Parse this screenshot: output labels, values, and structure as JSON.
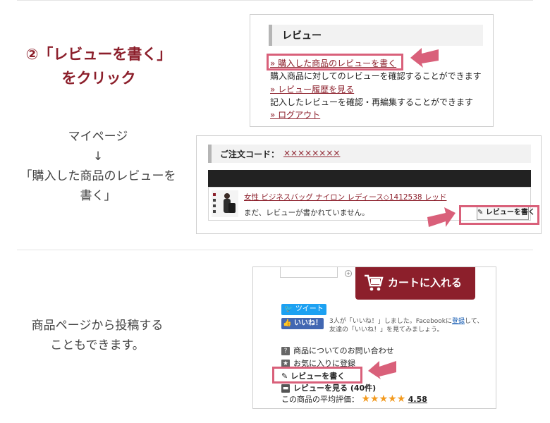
{
  "step": {
    "title_line1": "②「レビューを書く」",
    "title_line2": "をクリック"
  },
  "caption_mypage": {
    "line1": "マイページ",
    "line2": "↓",
    "line3": "「購入した商品のレビューを",
    "line4": "書く」"
  },
  "caption_product": {
    "line1": "商品ページから投稿する",
    "line2": "こともできます。"
  },
  "review_box": {
    "heading": "レビュー",
    "link_write": "» 購入した商品のレビューを書く",
    "desc_write": "購入商品に対してのレビューを確認することができます",
    "link_history": "» レビュー履歴を見る",
    "desc_history": "記入したレビューを確認・再編集することができます",
    "link_logout": "» ログアウト"
  },
  "order_box": {
    "order_code_label": "ご注文コード：",
    "order_code_value": "××××××××",
    "product_name": "女性 ビジネスバッグ ナイロン レディース◇1412538 レッド",
    "no_review_text": "まだ、レビューが書かれていません。",
    "write_review_button": "レビューを書く"
  },
  "product_page": {
    "cart_button": "カートに入れる",
    "tweet_button": "ツイート",
    "like_button": "いいね！",
    "fb_line1_prefix": "3人が「いいね！」しました。Facebookに",
    "fb_line1_link": "登録",
    "fb_line1_suffix": "して、",
    "fb_line2": "友達の「いいね！」を見てみましょう。",
    "inquiry": "商品についてのお問い合わせ",
    "favorite": "お気に入りに登録",
    "write_review": "レビューを書く",
    "view_reviews": "レビューを見る",
    "review_count": "(40件)",
    "avg_label": "この商品の平均評価：",
    "avg_value": "4.58",
    "rating": 4.58
  },
  "colors": {
    "accent": "#8c1f2b",
    "highlight": "#d9607a",
    "twitter": "#1da1f2",
    "facebook": "#4267b2",
    "star": "#f39a1e"
  }
}
